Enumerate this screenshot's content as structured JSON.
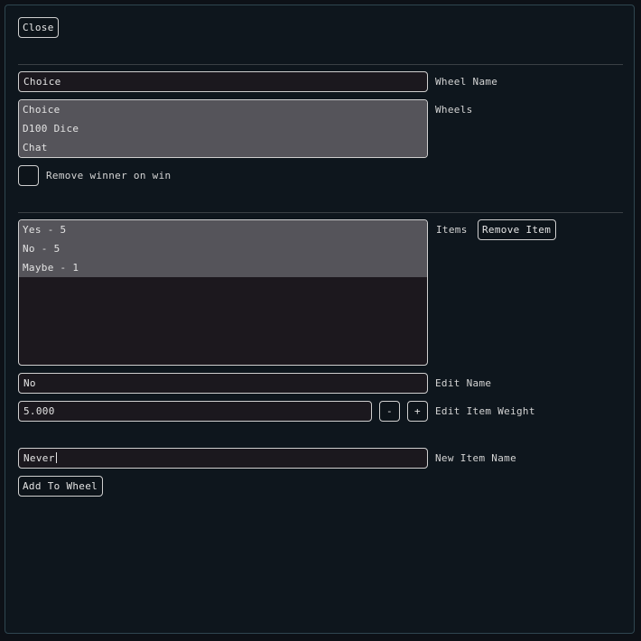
{
  "toolbar": {
    "close_label": "Close"
  },
  "wheel": {
    "name_value": "Choice",
    "name_label": "Wheel Name",
    "wheels_label": "Wheels",
    "wheels": [
      "Choice",
      "D100 Dice",
      "Chat"
    ],
    "remove_winner_label": "Remove winner on win",
    "remove_winner_checked": false
  },
  "items": {
    "label": "Items",
    "remove_button": "Remove Item",
    "list": [
      "Yes - 5",
      "No - 5",
      "Maybe - 1"
    ],
    "edit_name_value": "No",
    "edit_name_label": "Edit Name",
    "weight_value": "5.000",
    "weight_minus": "-",
    "weight_plus": "+",
    "weight_label": "Edit Item Weight",
    "new_item_value": "Never",
    "new_item_label": "New Item Name",
    "add_button": "Add To Wheel"
  },
  "colors": {
    "background": "#0e161d",
    "field": "#1b181e",
    "selected_row": "#55545a",
    "border": "#cfcfcf"
  }
}
